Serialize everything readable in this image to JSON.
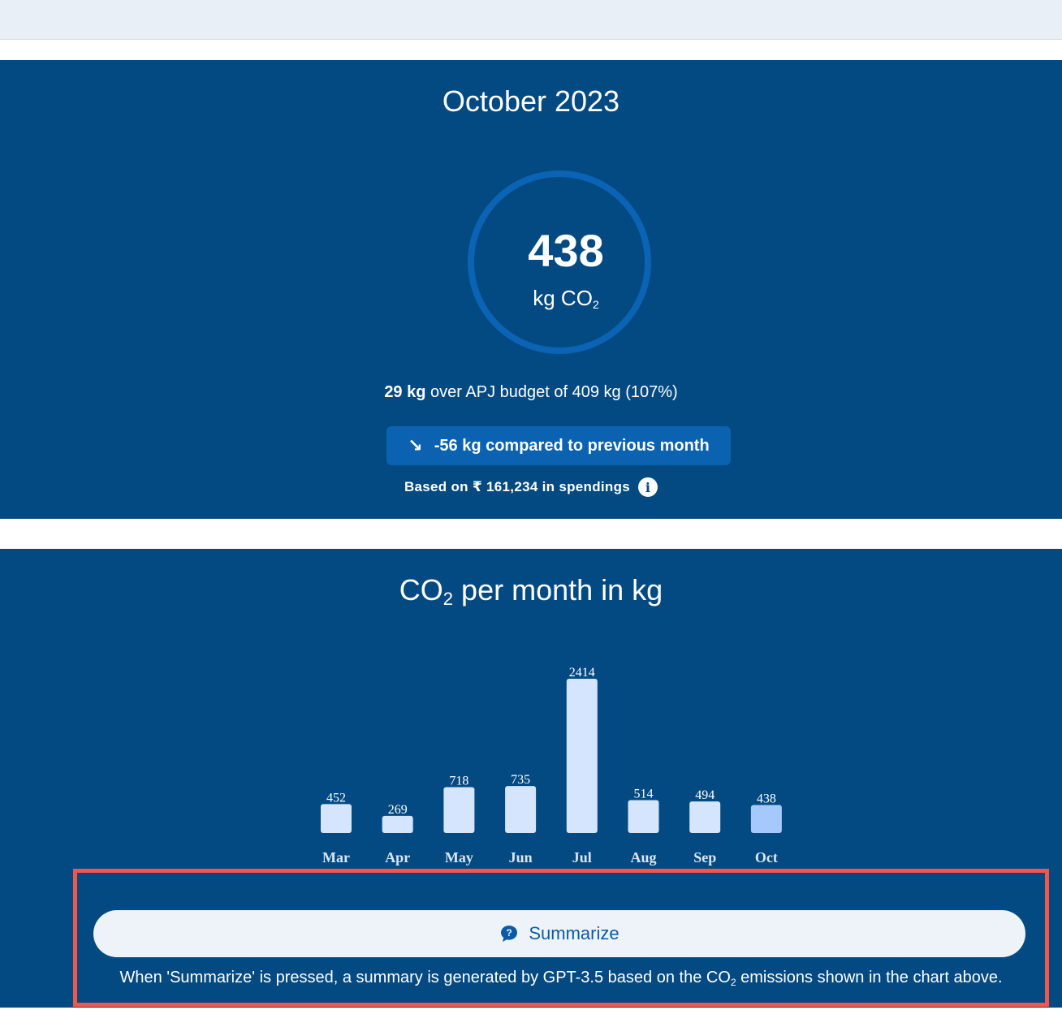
{
  "summary": {
    "month_title": "October 2023",
    "total_value": "438",
    "total_unit": "kg CO",
    "total_unit_sub": "2",
    "budget_bold": "29 kg",
    "budget_text": " over APJ budget of 409 kg (107%)",
    "compare_arrow": "↘",
    "compare_text": "-56 kg compared to previous month",
    "spend_text": "Based on ₹ 161,234 in spendings",
    "info_icon": "i"
  },
  "chart_section": {
    "title_prefix": "CO",
    "title_sub": "2",
    "title_suffix": " per month in kg"
  },
  "chart_data": {
    "type": "bar",
    "title": "CO2 per month in kg",
    "categories": [
      "Mar",
      "Apr",
      "May",
      "Jun",
      "Jul",
      "Aug",
      "Sep",
      "Oct"
    ],
    "values": [
      452,
      269,
      718,
      735,
      2414,
      514,
      494,
      438
    ],
    "highlight_index": 7,
    "colors": {
      "bar": "#d4e5fd",
      "highlight": "#a6c9fb",
      "label": "#ffffff"
    },
    "grid": false
  },
  "summarize": {
    "button_label": "Summarize",
    "note_prefix": "When 'Summarize' is pressed, a summary is generated by GPT-3.5 based on the CO",
    "note_sub": "2",
    "note_suffix": " emissions shown in the chart above."
  },
  "colors": {
    "panel_bg": "#034a82",
    "ring": "#0a63b4",
    "pill": "#0b62b0",
    "highlight_border": "#f2574a",
    "button_bg": "#eef3fa",
    "button_text": "#0b5aa8"
  }
}
